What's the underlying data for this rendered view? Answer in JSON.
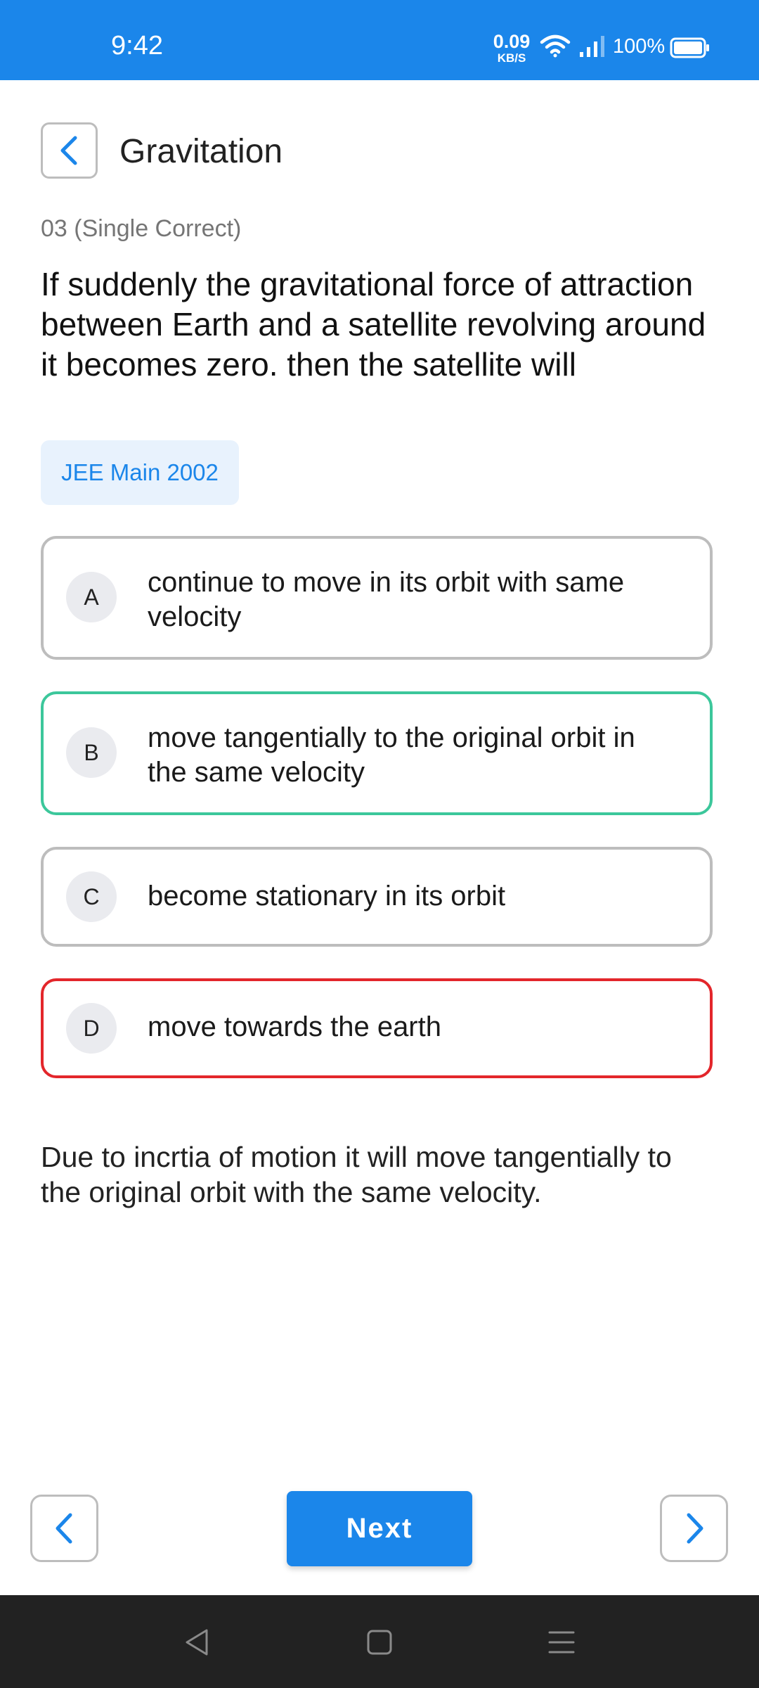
{
  "status_bar": {
    "time": "9:42",
    "net_speed_value": "0.09",
    "net_speed_unit": "KB/S",
    "battery_percent": "100%",
    "background_color": "#1b86ea"
  },
  "header": {
    "title": "Gravitation",
    "back_icon": "chevron-left-icon"
  },
  "question": {
    "meta": "03 (Single Correct)",
    "text": "If suddenly the gravitational force of attraction between Earth and a satellite revolving around it becomes zero. then the satellite will",
    "exam_tag": "JEE Main 2002"
  },
  "options": [
    {
      "letter": "A",
      "text": "continue to move in its orbit with same velocity",
      "state": "neutral"
    },
    {
      "letter": "B",
      "text": "move tangentially to the original orbit in the same velocity",
      "state": "correct"
    },
    {
      "letter": "C",
      "text": "become stationary in its orbit",
      "state": "neutral"
    },
    {
      "letter": "D",
      "text": "move towards the earth",
      "state": "wrong"
    }
  ],
  "explanation": "Due to incrtia of motion it will move tangentially to the original orbit with the same velocity.",
  "footer": {
    "next_label": "Next",
    "prev_icon": "chevron-left-icon",
    "forward_icon": "chevron-right-icon"
  },
  "colors": {
    "accent": "#1b86ea",
    "correct": "#3cc79b",
    "wrong": "#e3262b",
    "tag_bg": "#e8f2fd"
  },
  "system_nav": {
    "icons": [
      "back-triangle-icon",
      "home-square-icon",
      "menu-lines-icon"
    ]
  }
}
